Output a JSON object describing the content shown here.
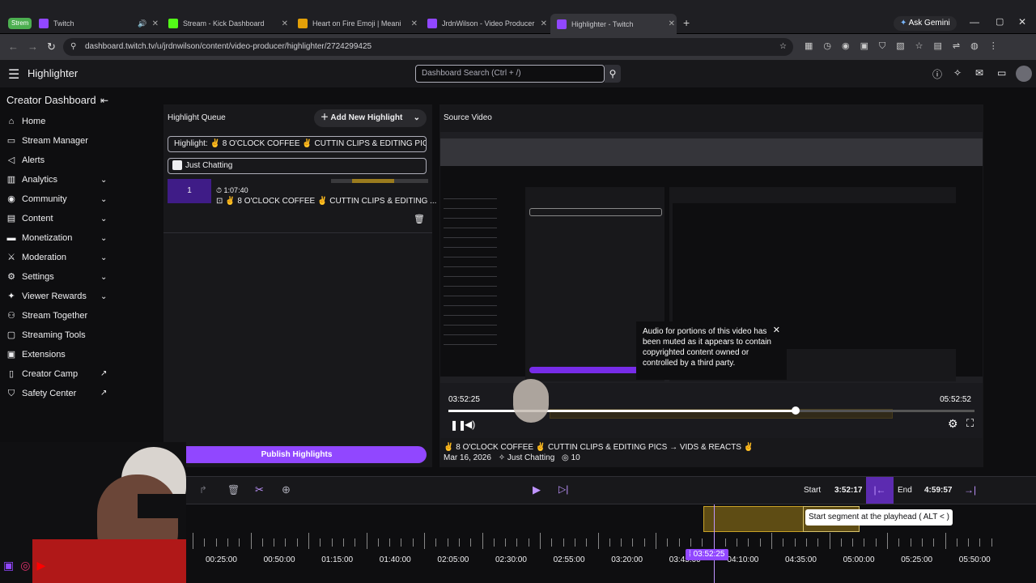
{
  "browser": {
    "profile_badge": "Strem",
    "tabs": [
      {
        "title": "Twitch"
      },
      {
        "title": "Stream - Kick Dashboard"
      },
      {
        "title": "Heart on Fire Emoji | Meani"
      },
      {
        "title": "JrdnWilson - Video Producer -"
      },
      {
        "title": "Highlighter - Twitch"
      }
    ],
    "new_tab": "+",
    "ask_gemini": "Ask Gemini",
    "url": "dashboard.twitch.tv/u/jrdnwilson/content/video-producer/highlighter/2724299425"
  },
  "topnav": {
    "title": "Highlighter",
    "search_placeholder": "Dashboard Search (Ctrl + /)"
  },
  "sidebar": {
    "header": "Creator Dashboard",
    "items": [
      {
        "label": "Home",
        "icon": "home-icon",
        "glyph": "⌂",
        "chevron": false,
        "external": false
      },
      {
        "label": "Stream Manager",
        "icon": "camera-icon",
        "glyph": "▭",
        "chevron": false,
        "external": false
      },
      {
        "label": "Alerts",
        "icon": "megaphone-icon",
        "glyph": "◁",
        "chevron": false,
        "external": false
      },
      {
        "label": "Analytics",
        "icon": "chart-icon",
        "glyph": "▥",
        "chevron": true,
        "external": false
      },
      {
        "label": "Community",
        "icon": "people-icon",
        "glyph": "◉",
        "chevron": true,
        "external": false
      },
      {
        "label": "Content",
        "icon": "content-icon",
        "glyph": "▤",
        "chevron": true,
        "external": false
      },
      {
        "label": "Monetization",
        "icon": "money-icon",
        "glyph": "▬",
        "chevron": true,
        "external": false
      },
      {
        "label": "Moderation",
        "icon": "sword-icon",
        "glyph": "⚔",
        "chevron": true,
        "external": false
      },
      {
        "label": "Settings",
        "icon": "gear-icon",
        "glyph": "⚙",
        "chevron": true,
        "external": false
      },
      {
        "label": "Viewer Rewards",
        "icon": "reward-icon",
        "glyph": "✦",
        "chevron": true,
        "external": false
      },
      {
        "label": "Stream Together",
        "icon": "stream-together-icon",
        "glyph": "⚇",
        "chevron": false,
        "external": false
      },
      {
        "label": "Streaming Tools",
        "icon": "tools-icon",
        "glyph": "▢",
        "chevron": false,
        "external": false
      },
      {
        "label": "Extensions",
        "icon": "extension-icon",
        "glyph": "▣",
        "chevron": false,
        "external": false
      },
      {
        "label": "Creator Camp",
        "icon": "book-icon",
        "glyph": "▯",
        "chevron": false,
        "external": true
      },
      {
        "label": "Safety Center",
        "icon": "shield-icon",
        "glyph": "⛉",
        "chevron": false,
        "external": true
      }
    ]
  },
  "queue": {
    "title": "Highlight Queue",
    "add_button": "Add New Highlight",
    "title_field": "Highlight: ✌ 8 O'CLOCK COFFEE ✌ CUTTIN CLIPS & EDITING PICS -",
    "category_field": "Just Chatting",
    "item": {
      "number": "1",
      "duration": "1:07:40",
      "title": "✌ 8 O'CLOCK COFFEE ✌ CUTTIN CLIPS & EDITING ..."
    },
    "publish_button": "Publish Highlights"
  },
  "source": {
    "title": "Source Video",
    "current_time": "03:52:25",
    "end_time": "05:52:52",
    "progress_fraction": 0.66,
    "muted_notice": "Audio for portions of this video has been muted as it appears to contain copyrighted content owned or controlled by a third party.",
    "video_title": "✌ 8 O'CLOCK COFFEE ✌ CUTTIN CLIPS & EDITING PICS → VIDS & REACTS ✌",
    "date": "Mar 16, 2026",
    "category": "Just Chatting",
    "viewers": "10"
  },
  "timeline": {
    "start_label": "Start",
    "start_time": "3:52:17",
    "end_label": "End",
    "end_time": "4:59:57",
    "tooltip": "Start segment at the playhead ( ALT < )",
    "playhead": "03:52:25",
    "ticks": [
      "00:25:00",
      "00:50:00",
      "01:15:00",
      "01:40:00",
      "02:05:00",
      "02:30:00",
      "02:55:00",
      "03:20:00",
      "03:45:00",
      "04:10:00",
      "04:35:00",
      "05:00:00",
      "05:25:00",
      "05:50:00"
    ]
  },
  "colors": {
    "accent": "#772ce8",
    "publish": "#9147ff",
    "segment": "#c9a227",
    "bg": "#0e0e10",
    "panel": "#18181b"
  }
}
